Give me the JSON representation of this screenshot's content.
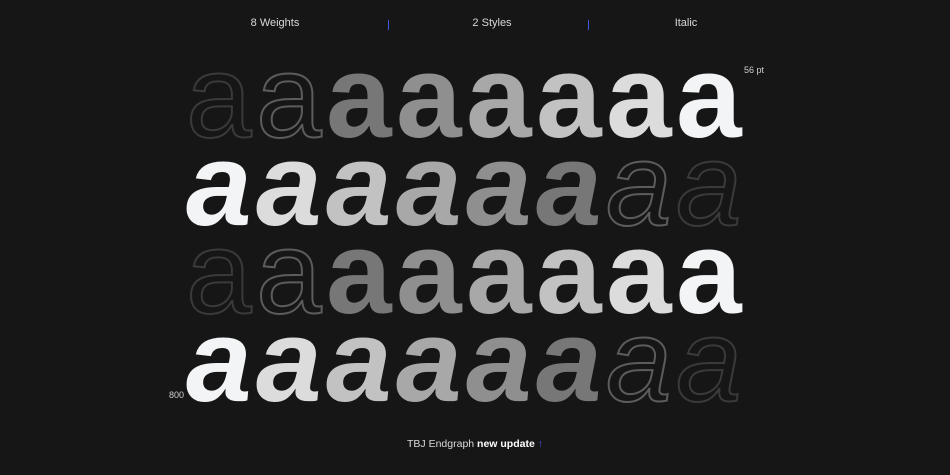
{
  "header": {
    "weights": "8 Weights",
    "styles": "2 Styles",
    "italic": "Italic"
  },
  "size_label": "56 pt",
  "weight_label": "800",
  "glyph": "a",
  "rows": [
    {
      "italic": false,
      "shades": [
        "#3a3a3a",
        "#5c5c5c",
        "#777777",
        "#8f8f8f",
        "#a8a8a8",
        "#c2c2c2",
        "#dcdcdc",
        "#f2f4f5"
      ],
      "fill": [
        0,
        0,
        1,
        1,
        1,
        1,
        1,
        1
      ]
    },
    {
      "italic": true,
      "shades": [
        "#f2f4f5",
        "#dcdcdc",
        "#c2c2c2",
        "#a8a8a8",
        "#8f8f8f",
        "#777777",
        "#5c5c5c",
        "#3a3a3a"
      ],
      "fill": [
        1,
        1,
        1,
        1,
        1,
        1,
        0,
        0
      ]
    },
    {
      "italic": false,
      "shades": [
        "#3a3a3a",
        "#5c5c5c",
        "#777777",
        "#8f8f8f",
        "#a8a8a8",
        "#c2c2c2",
        "#dcdcdc",
        "#f2f4f5"
      ],
      "fill": [
        0,
        0,
        1,
        1,
        1,
        1,
        1,
        1
      ]
    },
    {
      "italic": true,
      "shades": [
        "#f2f4f5",
        "#dcdcdc",
        "#c2c2c2",
        "#a8a8a8",
        "#8f8f8f",
        "#777777",
        "#5c5c5c",
        "#3a3a3a"
      ],
      "fill": [
        1,
        1,
        1,
        1,
        1,
        1,
        0,
        0
      ]
    }
  ],
  "footer": {
    "name": "TBJ Endgraph",
    "highlight": "new update",
    "arrow": "↑"
  },
  "colors": {
    "background": "#161616",
    "accent": "#3b5bd9"
  }
}
